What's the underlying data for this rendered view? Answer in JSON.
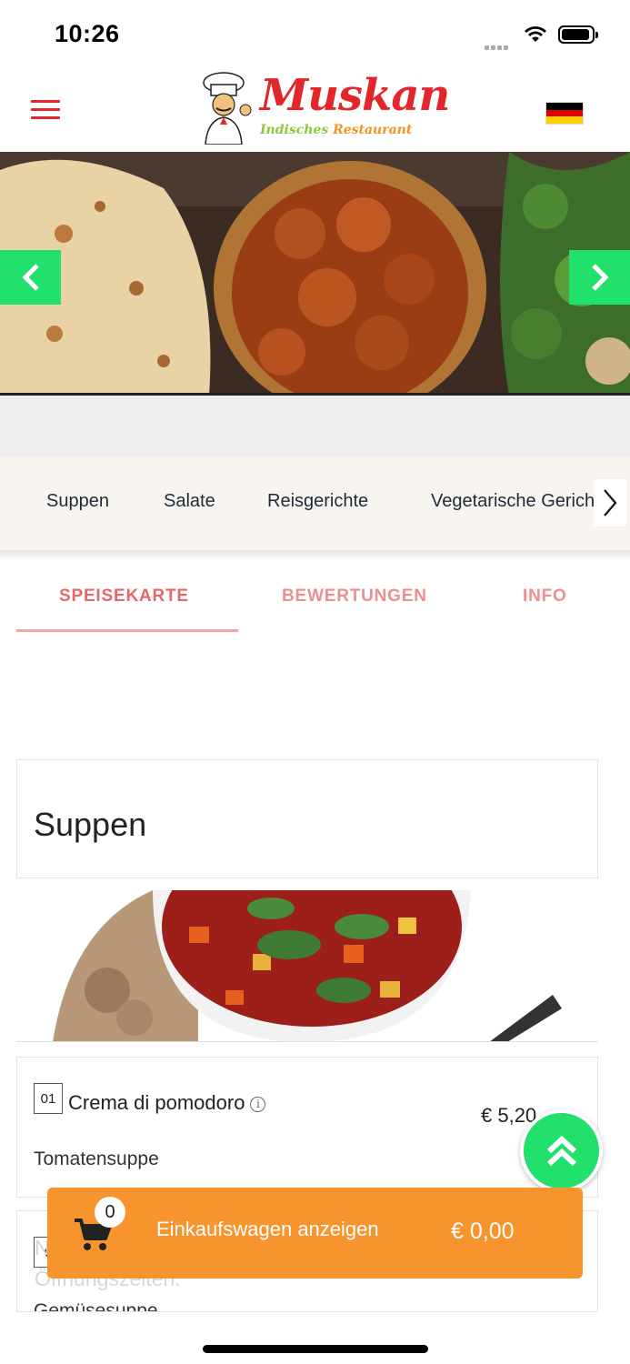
{
  "status": {
    "time": "10:26"
  },
  "header": {
    "logo_title": "Muskan",
    "logo_sub_1": "Indisches",
    "logo_sub_2": "Restaurant",
    "language_flag": "de"
  },
  "categories": {
    "items": [
      "Suppen",
      "Salate",
      "Reisgerichte",
      "Vegetarische Gerichte"
    ],
    "next_icon": "chevron-right"
  },
  "tabs": [
    {
      "label": "SPEISEKARTE",
      "active": true
    },
    {
      "label": "BEWERTUNGEN",
      "active": false
    },
    {
      "label": "INFO",
      "active": false
    }
  ],
  "section": {
    "title": "Suppen"
  },
  "items": [
    {
      "number": "01",
      "name": "Crema di pomodoro",
      "price": "€ 5,20",
      "description": "Tomatensuppe"
    },
    {
      "number": "0",
      "name": "",
      "price": "",
      "description": "Gemüsesuppe"
    }
  ],
  "notice": "Nur Vorbestellung möglich. Bitte beachten Sie unsere Öffnungszeiten.",
  "cart": {
    "count": "0",
    "label": "Einkaufswagen anzeigen",
    "total": "€ 0,00"
  },
  "colors": {
    "brand_red": "#e3262b",
    "accent_green": "#21e06b",
    "cart_orange": "#f7942d",
    "tab_pink": "#e96669"
  }
}
